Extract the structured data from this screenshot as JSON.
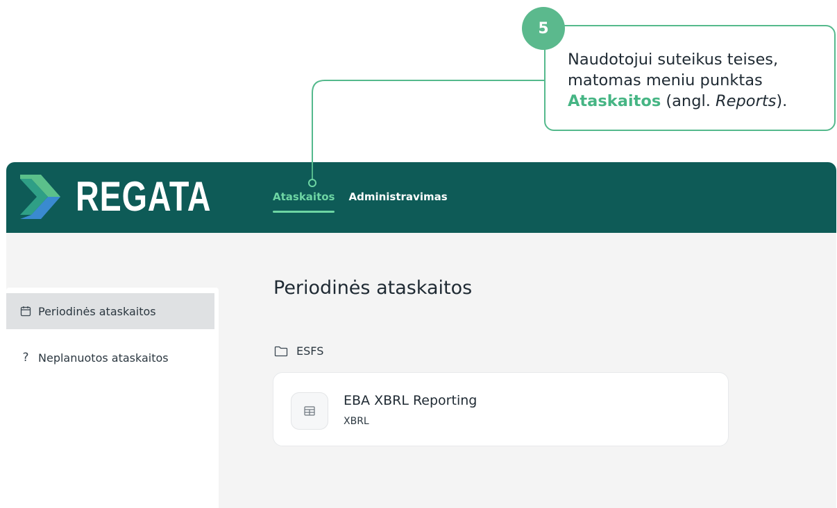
{
  "callout": {
    "number": "5",
    "line1": "Naudotojui suteikus teises,",
    "line2": "matomas meniu punktas",
    "highlight": "Ataskaitos",
    "line3_mid": " (angl. ",
    "line3_italic": "Reports",
    "line3_end": ")."
  },
  "brand": {
    "name": "REGATA"
  },
  "nav": [
    {
      "label": "Ataskaitos",
      "active": true
    },
    {
      "label": "Administravimas",
      "active": false
    }
  ],
  "sidebar": {
    "items": [
      {
        "label": "Periodinės ataskaitos",
        "icon": "calendar-icon",
        "active": true
      },
      {
        "label": "Neplanuotos ataskaitos",
        "icon": "question-icon",
        "active": false
      }
    ]
  },
  "main": {
    "title": "Periodinės ataskaitos",
    "folder": {
      "name": "ESFS",
      "icon": "folder-icon"
    },
    "cards": [
      {
        "title": "EBA XBRL Reporting",
        "subtitle": "XBRL",
        "icon": "table-icon"
      }
    ]
  },
  "colors": {
    "topbar": "#0e5b57",
    "accent": "#6dd5a3",
    "callout_border": "#54b98c",
    "badge": "#5bb98d"
  }
}
